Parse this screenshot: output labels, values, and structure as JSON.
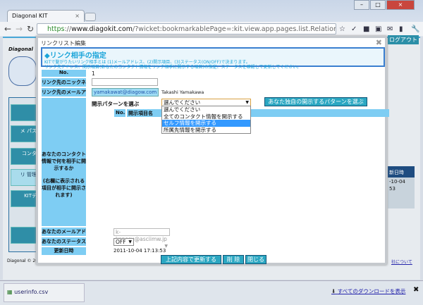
{
  "browser": {
    "tab_title": "Diagonal KIT",
    "url_scheme": "https",
    "url_sep": "://",
    "url_host": "www.diagokit.com",
    "url_path": "/?wicket:bookmarkablePage=:kit.view.app.pages.list.RelationListPage"
  },
  "background": {
    "logo": "Diagonal",
    "logout": "ログアウト",
    "side_items": [
      "メ パス",
      "コンタ",
      "リ 管理",
      "KITデ"
    ],
    "right_header": "新日時",
    "right_values": [
      "-10-04",
      "53"
    ],
    "footer": "Diagonal © 201",
    "footer_link": "社について"
  },
  "dialog": {
    "title": "リンクリスト編集",
    "header_title": "◆リンク相手の指定",
    "header_desc1": "KITで繋がりたいリンク相手とは (1)メールアドレス、(2)開示項目、(3)ステータス(ON/OFF)で決まります。",
    "header_desc2": "リンク先アドレス、開示項目(あなたのコンタクト情報をリンク相手に開示する項目)の指定、ステータスを確認して更新してください。",
    "labels": {
      "no": "No.",
      "nickname": "リンク先のニックネーム",
      "email": "リンク先のメールアドレス",
      "disclose": "あなたのコンタクト情報で何を相手に開示するか",
      "disclose_note": "(右欄に表示される項目が相手に開示されます)",
      "my_email": "あなたのメールアドレス",
      "status": "あなたのステータス",
      "updated": "更新日時"
    },
    "values": {
      "no": "1",
      "nickname": "",
      "email": "yamakawat@diagow.com",
      "email_name": "Takashi Yamakawa",
      "my_email": "k-konosu@asciimw.jp",
      "status": "OFF",
      "updated": "2011-10-04 17:13:53"
    },
    "pattern_label": "開示パターンを選ぶ",
    "pattern_selected": "選んでください",
    "pattern_options": [
      "選んでください",
      "全てのコンタクト情報を開示する",
      "セルフ情報を開示する",
      "所属先情報を開示する"
    ],
    "pattern_highlighted_index": 2,
    "custom_pattern_button": "あなた独自の開示するパターンを選ぶ",
    "table_headers": [
      "No.",
      "開示項目名"
    ],
    "buttons": {
      "update": "上記内容で更新する",
      "delete": "削 除",
      "close": "閉じる"
    }
  },
  "downloads": {
    "file": "userinfo.csv",
    "show_all": "すべてのダウンロードを表示"
  }
}
